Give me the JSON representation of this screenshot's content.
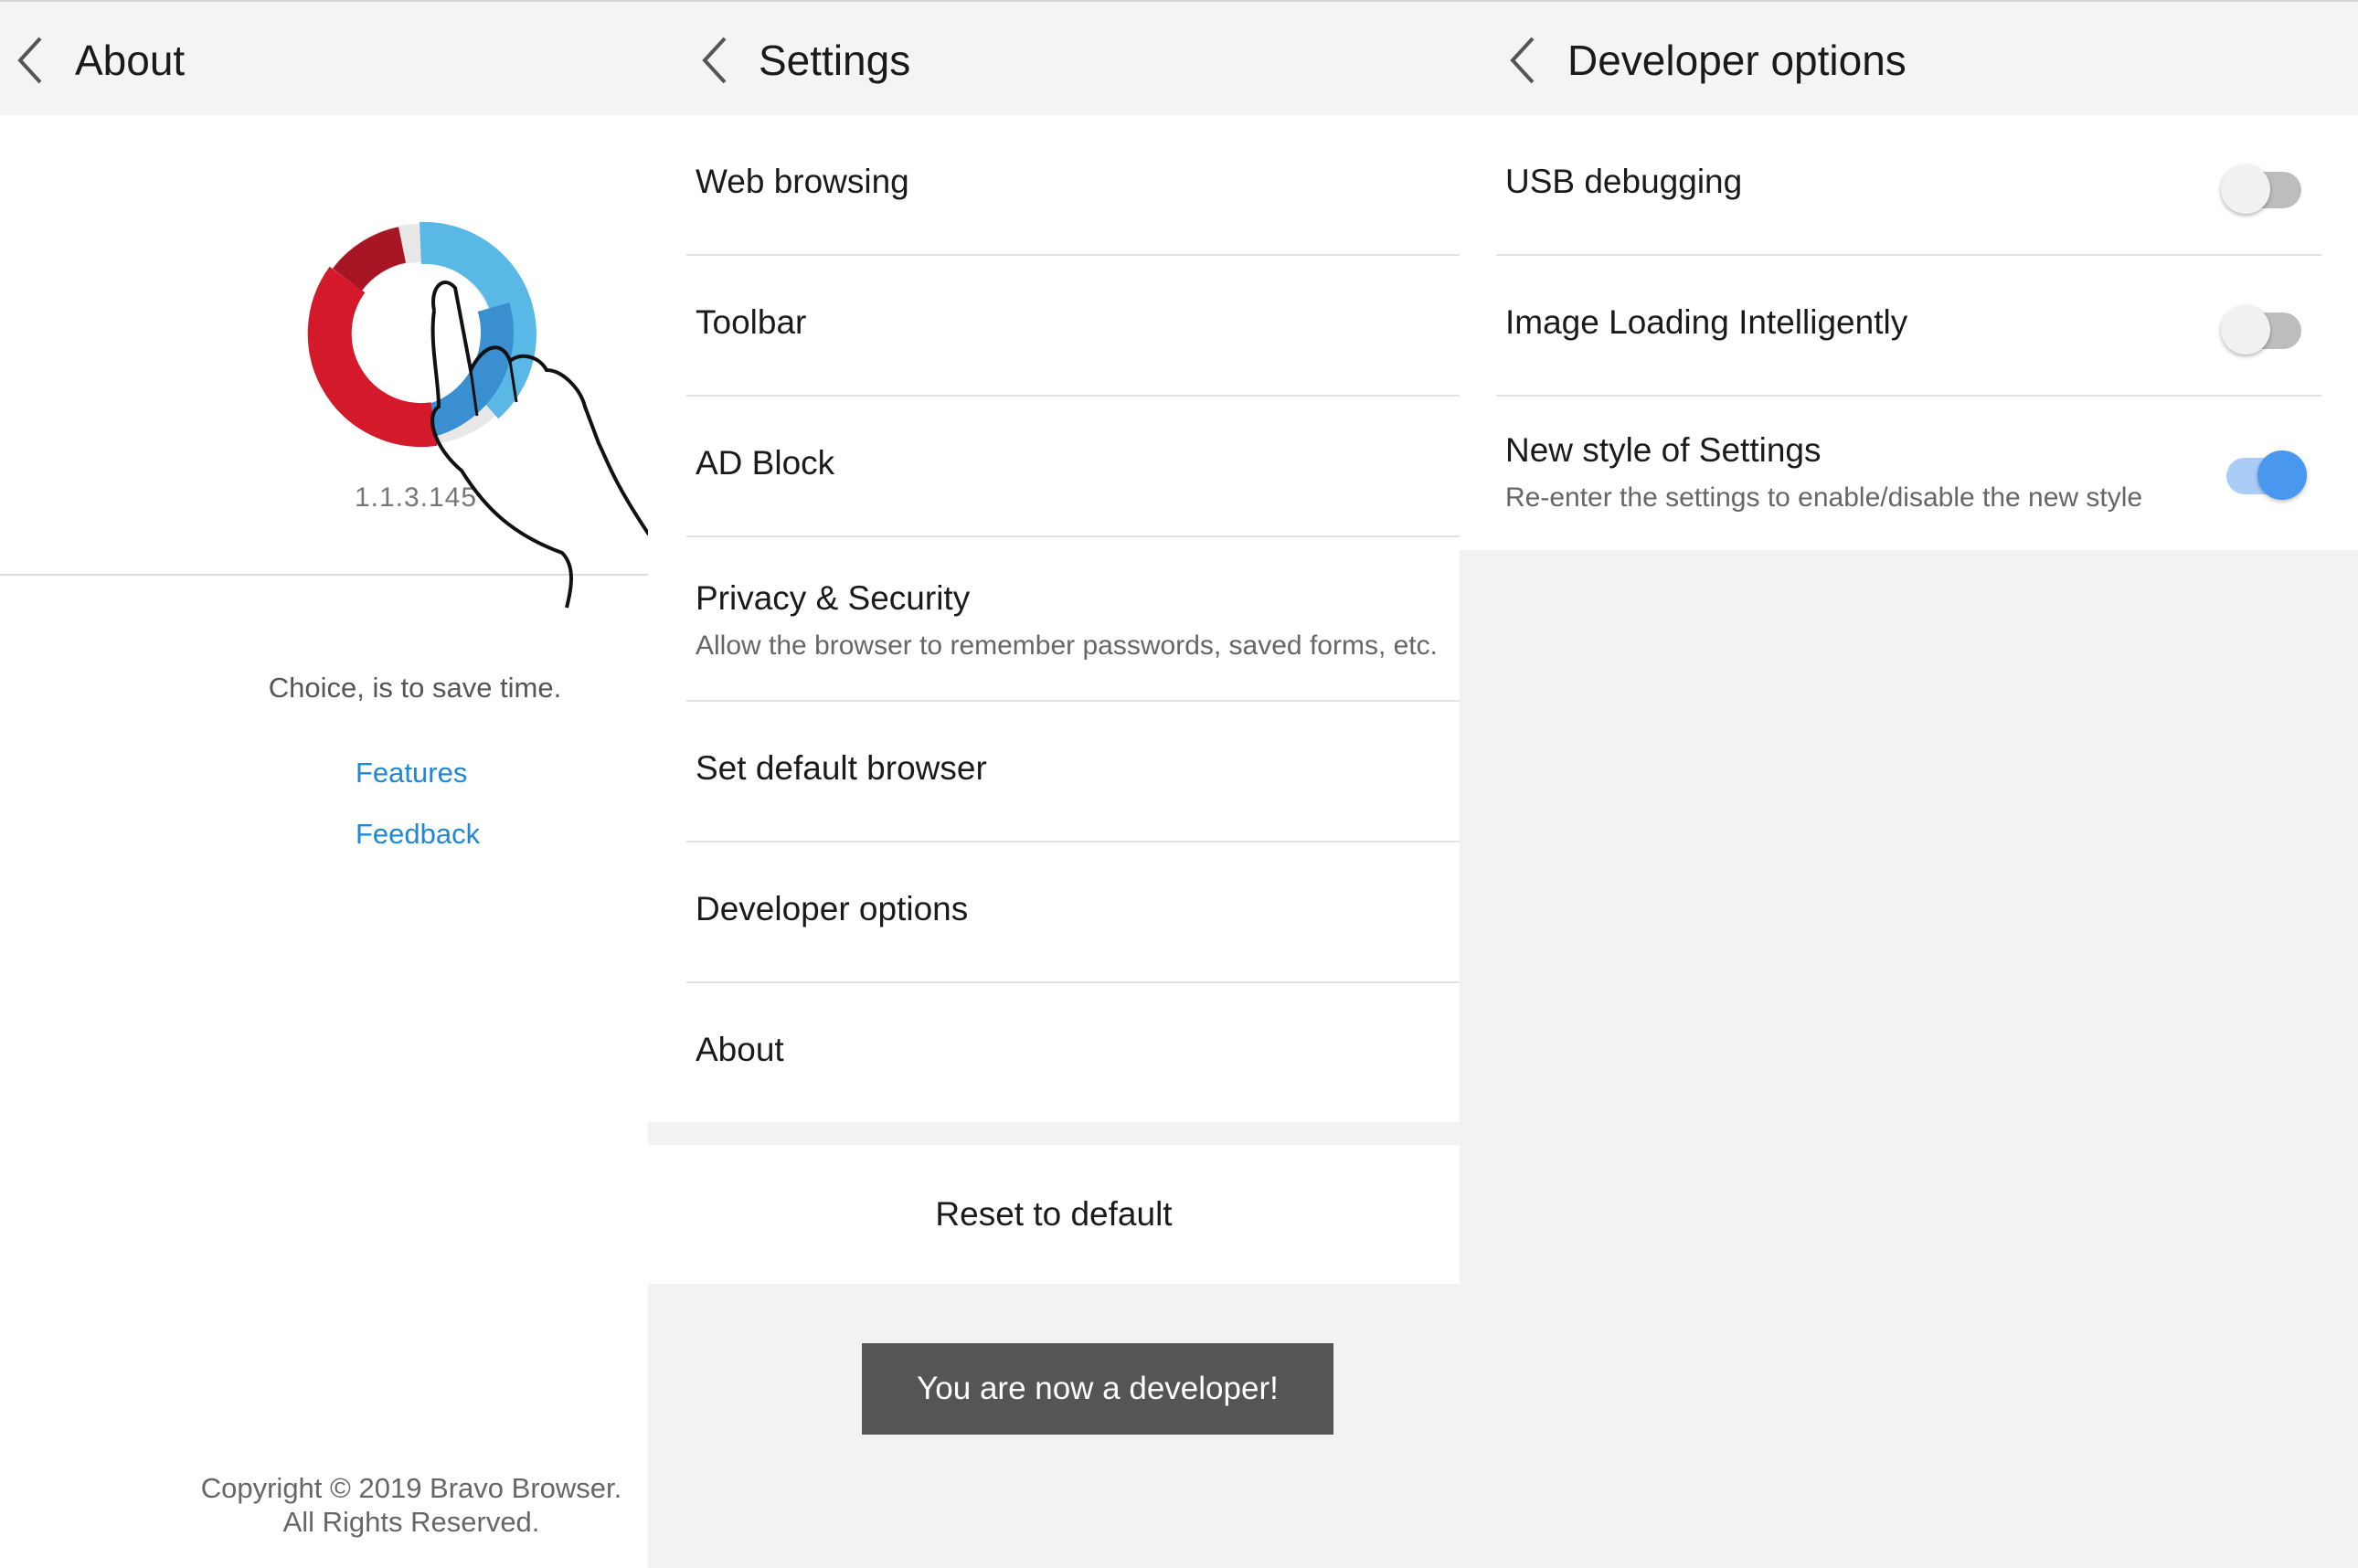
{
  "about": {
    "title": "About",
    "version": "1.1.3.145",
    "tagline": "Choice, is to save time.",
    "links": [
      "Features",
      "Feedback"
    ],
    "copyright_line1": "Copyright © 2019 Bravo Browser.",
    "copyright_line2": "All Rights Reserved."
  },
  "settings": {
    "title": "Settings",
    "items": [
      {
        "label": "Web browsing"
      },
      {
        "label": "Toolbar"
      },
      {
        "label": "AD Block"
      },
      {
        "label": "Privacy & Security",
        "sub": "Allow the browser to remember passwords, saved forms, etc."
      },
      {
        "label": "Set default browser"
      },
      {
        "label": "Developer options"
      },
      {
        "label": "About"
      }
    ],
    "reset_label": "Reset to default",
    "toast": "You are now a developer!"
  },
  "developer": {
    "title": "Developer options",
    "items": [
      {
        "label": "USB debugging",
        "enabled": false
      },
      {
        "label": "Image Loading Intelligently",
        "enabled": false
      },
      {
        "label": "New style of Settings",
        "sub": "Re-enter the settings to enable/disable the new style",
        "enabled": true
      }
    ]
  },
  "colors": {
    "link": "#1e88d6",
    "toggle_on": "#4a97f0",
    "toast_bg": "#555555",
    "logo_red": "#d4192b",
    "logo_blue": "#5ab8e6"
  },
  "icons": [
    "back-chevron-icon",
    "app-logo-icon",
    "hand-pointer-icon"
  ]
}
